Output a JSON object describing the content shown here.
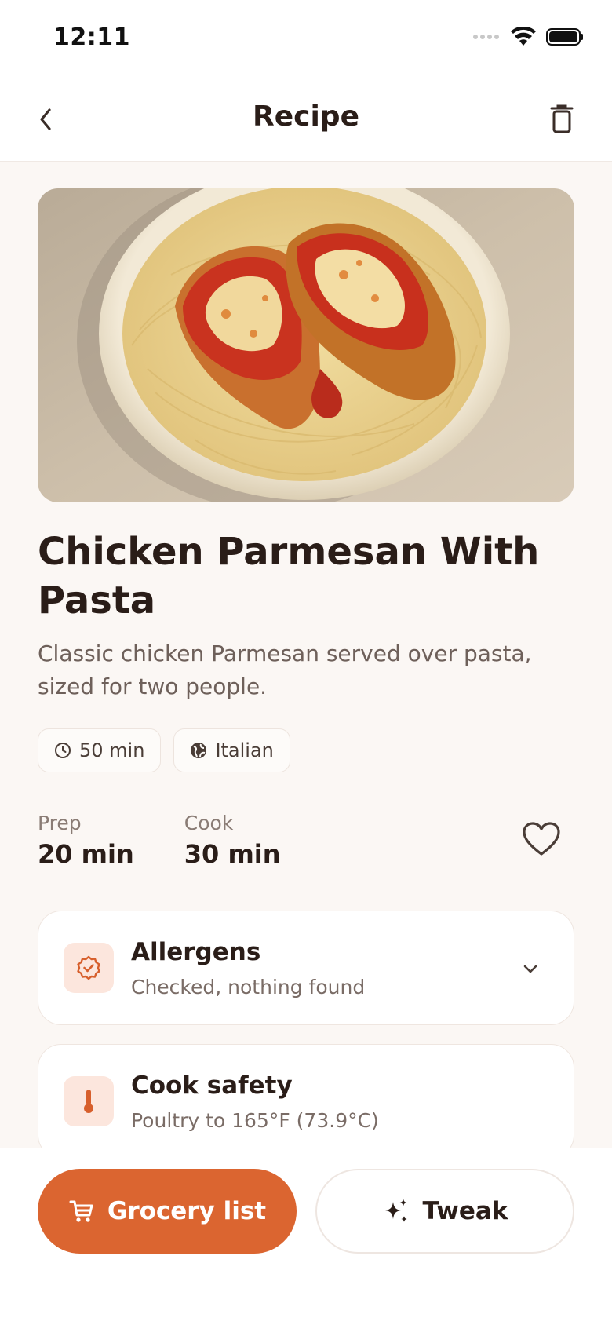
{
  "status_bar": {
    "time": "12:11"
  },
  "nav": {
    "title": "Recipe"
  },
  "recipe": {
    "title": "Chicken Parmesan With Pasta",
    "description": "Classic chicken Parmesan served over pasta, sized for two people.",
    "chips": [
      {
        "icon": "clock-icon",
        "label": "50 min"
      },
      {
        "icon": "globe-icon",
        "label": "Italian"
      }
    ],
    "prep": {
      "label": "Prep",
      "value": "20 min"
    },
    "cook": {
      "label": "Cook",
      "value": "30 min"
    }
  },
  "cards": [
    {
      "icon": "badge-check-icon",
      "title": "Allergens",
      "subtitle": "Checked, nothing found",
      "expandable": true
    },
    {
      "icon": "thermometer-icon",
      "title": "Cook safety",
      "subtitle": "Poultry to 165°F (73.9°C)",
      "expandable": false
    }
  ],
  "actions": {
    "grocery_label": "Grocery list",
    "tweak_label": "Tweak"
  },
  "colors": {
    "accent": "#DB6530",
    "background": "#FBF7F4",
    "icon_tint": "#FCE6DD",
    "text": "#2A1D18"
  }
}
